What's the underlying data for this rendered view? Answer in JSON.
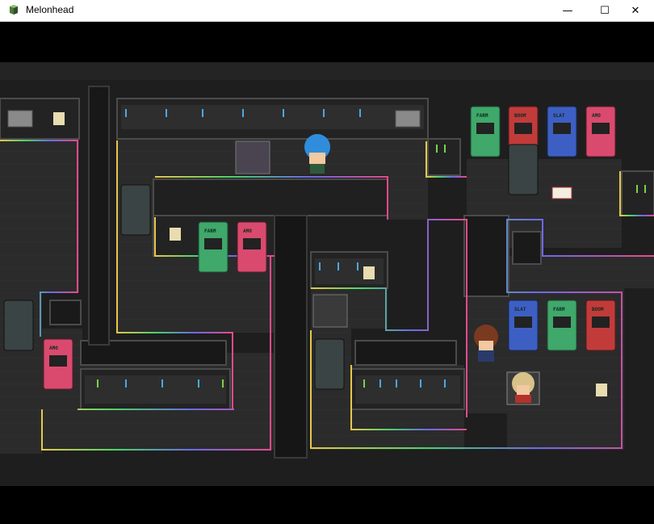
{
  "window": {
    "title": "Melonhead",
    "controls": {
      "minimize": "—",
      "maximize": "☐",
      "close": "✕"
    }
  },
  "icons": {
    "app": "melonhead-app-icon",
    "minimize": "minimize-icon",
    "maximize": "maximize-icon",
    "close": "close-icon"
  },
  "arcade_labels": {
    "farm": "FARM",
    "boom": "BOOM",
    "slat": "SLAT",
    "ammo": "AMO"
  },
  "colors": {
    "floor": "#2b2b2b",
    "wall": "#1f1f1f",
    "wall_edge": "#4b4b4b",
    "cabinet_green": "#3fa86a",
    "cabinet_red": "#c23b3b",
    "cabinet_blue": "#3d5fc4",
    "cabinet_pink": "#d94a6e",
    "player_hair": "#2f8ddc"
  }
}
